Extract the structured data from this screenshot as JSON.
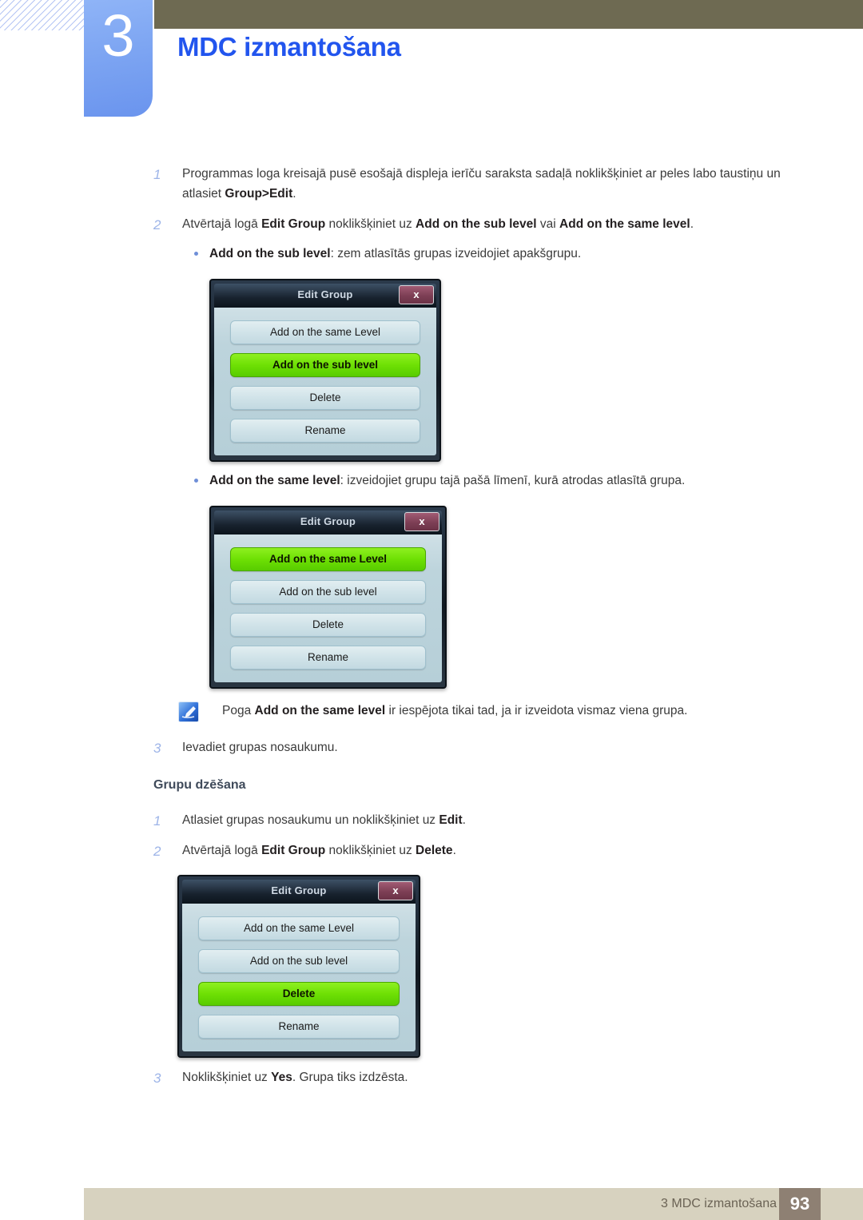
{
  "header": {
    "chapter_number": "3",
    "chapter_title": "MDC izmantošana",
    "accent_blue": "#2255ee",
    "tab_blue": "#7da5f2",
    "olive": "#6e6a52"
  },
  "steps": {
    "s1_num": "1",
    "s1_a": "Programmas loga kreisajā pusē esošajā displeja ierīču saraksta sadaļā noklikšķiniet ar peles labo taustiņu un atlasiet ",
    "s1_b": "Group>Edit",
    "s1_c": ".",
    "s2_num": "2",
    "s2_a": "Atvērtajā logā ",
    "s2_b": "Edit Group",
    "s2_c": " noklikšķiniet uz ",
    "s2_d": "Add on the sub level",
    "s2_e": " vai ",
    "s2_f": "Add on the same level",
    "s2_g": ".",
    "b1_b": "Add on the sub level",
    "b1_rest": ": zem atlasītās grupas izveidojiet apakšgrupu.",
    "b2_b": "Add on the same level",
    "b2_rest": ": izveidojiet grupu tajā pašā līmenī, kurā atrodas atlasītā grupa.",
    "s3_num": "3",
    "s3_text": "Ievadiet grupas nosaukumu."
  },
  "note": {
    "icon": "note-pencil-icon",
    "a": "Poga ",
    "b": "Add on the same level",
    "c": " ir iespējota tikai tad, ja ir izveidota vismaz viena grupa."
  },
  "deletion_section": {
    "heading": "Grupu dzēšana",
    "d1_num": "1",
    "d1_a": "Atlasiet grupas nosaukumu un noklikšķiniet uz ",
    "d1_b": "Edit",
    "d1_c": ".",
    "d2_num": "2",
    "d2_a": "Atvērtajā logā ",
    "d2_b": "Edit Group",
    "d2_c": " noklikšķiniet uz ",
    "d2_d": "Delete",
    "d2_e": ".",
    "d3_num": "3",
    "d3_a": "Noklikšķiniet uz ",
    "d3_b": "Yes",
    "d3_c": ". Grupa tiks izdzēsta."
  },
  "dialogs": {
    "title": "Edit Group",
    "close_label": "x",
    "btn_same_level": "Add on the same Level",
    "btn_sub_level": "Add on the sub level",
    "btn_delete": "Delete",
    "btn_rename": "Rename",
    "highlight_green": "#6ee004"
  },
  "footer": {
    "text": "3 MDC izmantošana",
    "page": "93",
    "bar_color": "#d7d2bf",
    "page_box_color": "#8e8073"
  }
}
